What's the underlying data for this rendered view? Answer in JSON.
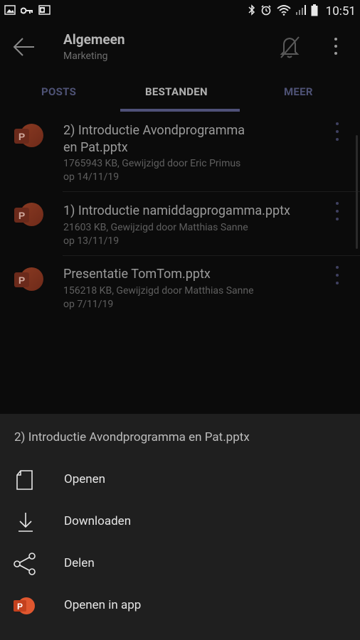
{
  "status_bar": {
    "time": "10:51"
  },
  "header": {
    "title": "Algemeen",
    "subtitle": "Marketing"
  },
  "tabs": [
    {
      "label": "POSTS"
    },
    {
      "label": "BESTANDEN"
    },
    {
      "label": "MEER"
    }
  ],
  "files": [
    {
      "name_line1": "2) Introductie Avondprogramma",
      "name_line2": "en Pat.pptx",
      "meta_line1": "1765943 KB, Gewijzigd door Eric Primus",
      "meta_line2": "op 14/11/19",
      "icon": "powerpoint-icon"
    },
    {
      "name_line1": "1) Introductie namiddagprogamma.pptx",
      "meta_line1": "21603 KB, Gewijzigd door Matthias Sanne",
      "meta_line2": "op 13/11/19",
      "icon": "powerpoint-icon"
    },
    {
      "name_line1": "Presentatie TomTom.pptx",
      "meta_line1": "156218 KB, Gewijzigd door Matthias Sanne",
      "meta_line2": "op 7/11/19",
      "icon": "powerpoint-icon"
    }
  ],
  "sheet": {
    "title": "2) Introductie Avondprogramma en Pat.pptx",
    "actions": [
      {
        "label": "Openen",
        "icon": "document-icon"
      },
      {
        "label": "Downloaden",
        "icon": "download-icon"
      },
      {
        "label": "Delen",
        "icon": "share-icon"
      },
      {
        "label": "Openen in app",
        "icon": "powerpoint-icon"
      }
    ]
  },
  "colors": {
    "background": "#0b0b0b",
    "sheet": "#1f1f1f",
    "accent": "#4f5178",
    "powerpoint": "#d24726"
  }
}
